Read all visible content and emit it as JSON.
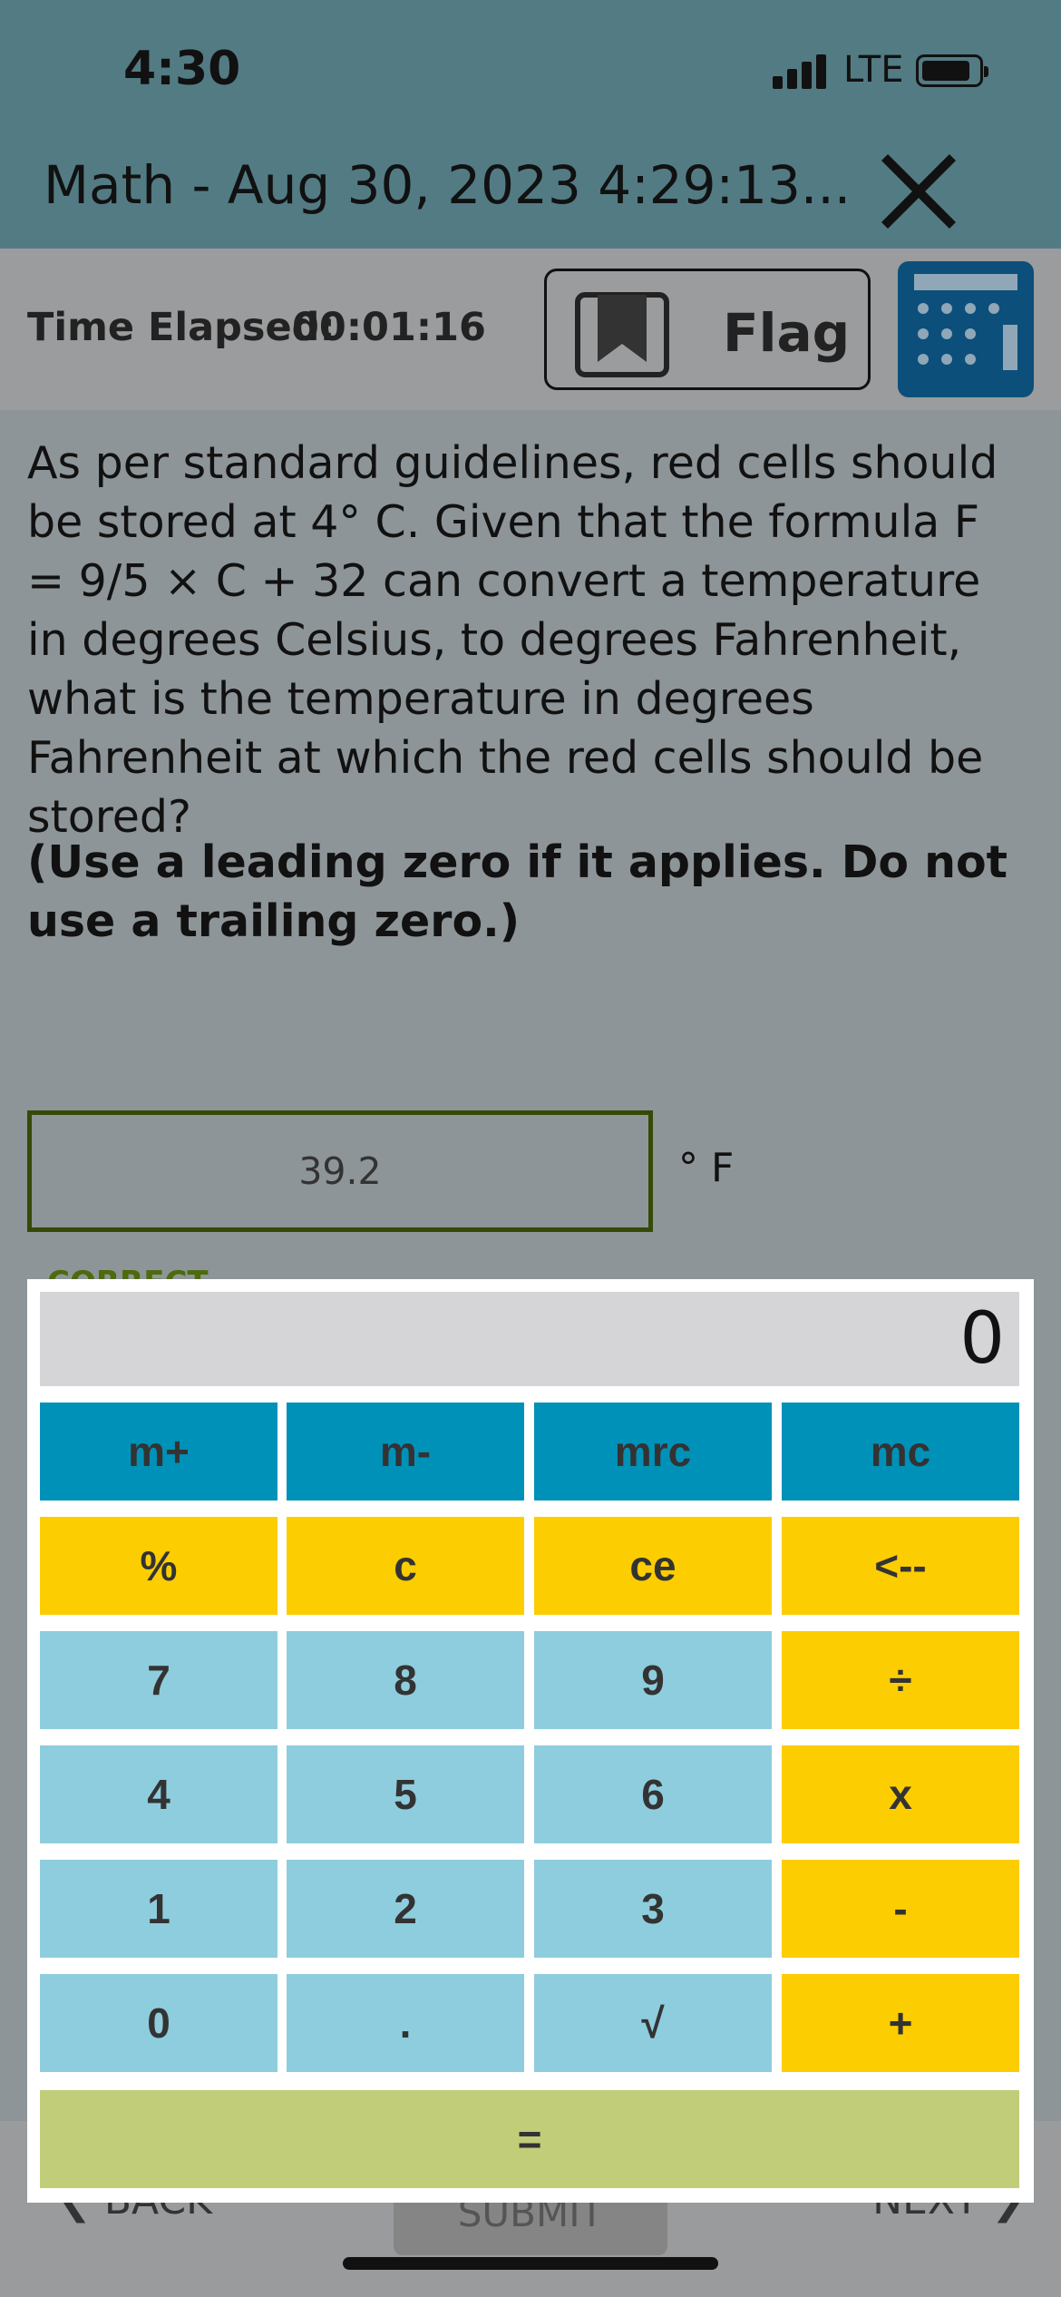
{
  "status_bar": {
    "time": "4:30",
    "network": "LTE"
  },
  "header": {
    "title": "Math - Aug 30, 2023 4:29:13..."
  },
  "toolbar": {
    "elapsed_label": "Time Elapsed:",
    "elapsed_value": "00:01:16",
    "flag_label": "Flag"
  },
  "question": {
    "text": "As per standard guidelines, red cells should be stored at 4° C. Given that the formula F = 9/5 × C + 32 can convert a temperature in degrees Celsius, to degrees Fahrenheit, what is the temperature in degrees Fahrenheit at which the red cells should be stored?",
    "instruction": "(Use a leading zero if it applies. Do not use a trailing zero.)"
  },
  "answer": {
    "value": "39.2",
    "unit": "° F",
    "feedback": "CORRECT"
  },
  "calculator": {
    "display": "0",
    "rows": [
      [
        "m+",
        "m-",
        "mrc",
        "mc"
      ],
      [
        "%",
        "c",
        "ce",
        "<--"
      ],
      [
        "7",
        "8",
        "9",
        "÷"
      ],
      [
        "4",
        "5",
        "6",
        "x"
      ],
      [
        "1",
        "2",
        "3",
        "-"
      ],
      [
        "0",
        ".",
        "√",
        "+"
      ]
    ],
    "equals": "="
  },
  "footer": {
    "back": "BACK",
    "submit": "SUBMIT",
    "next": "NEXT"
  },
  "colors": {
    "header": "#537b84",
    "memory_key": "#0091b8",
    "operator_key": "#fccd00",
    "number_key": "#8ecddd",
    "equals_key": "#c2cd79"
  }
}
